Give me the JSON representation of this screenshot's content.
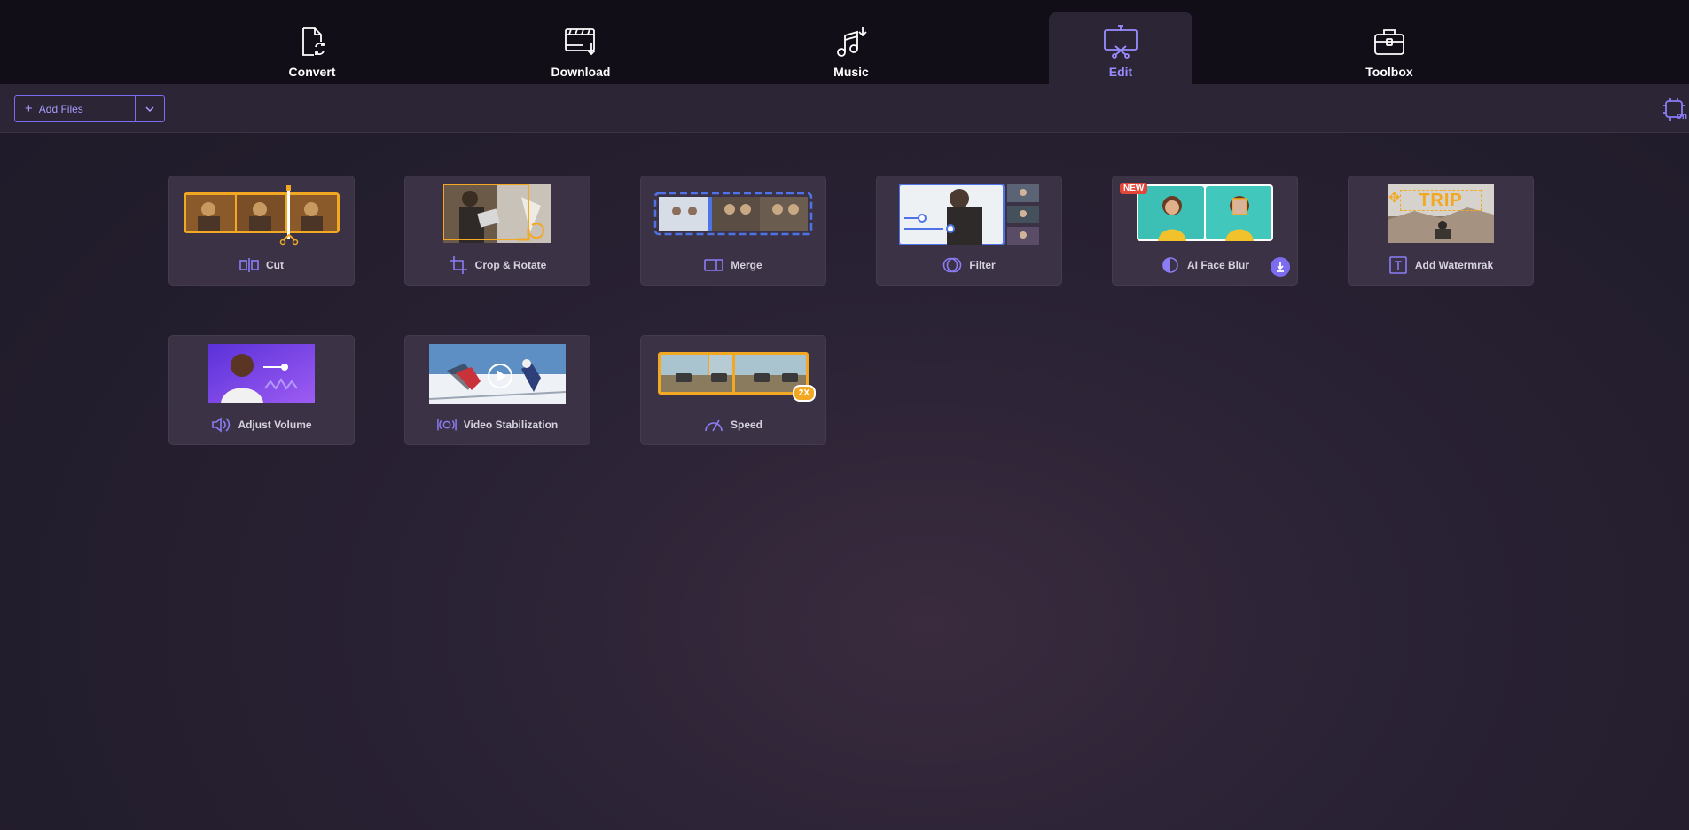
{
  "nav": {
    "tabs": [
      {
        "label": "Convert",
        "icon": "convert-icon"
      },
      {
        "label": "Download",
        "icon": "download-icon"
      },
      {
        "label": "Music",
        "icon": "music-icon"
      },
      {
        "label": "Edit",
        "icon": "edit-icon",
        "active": true
      },
      {
        "label": "Toolbox",
        "icon": "toolbox-icon"
      }
    ]
  },
  "toolbar": {
    "add_files_label": "Add Files",
    "gpu_label": "on"
  },
  "tools": [
    {
      "label": "Cut",
      "icon": "cut-icon"
    },
    {
      "label": "Crop & Rotate",
      "icon": "crop-icon"
    },
    {
      "label": "Merge",
      "icon": "merge-icon"
    },
    {
      "label": "Filter",
      "icon": "filter-icon"
    },
    {
      "label": "AI Face Blur",
      "icon": "face-blur-icon",
      "badge": "NEW"
    },
    {
      "label": "Add Watermrak",
      "icon": "watermark-icon",
      "thumb_text": "TRIP"
    },
    {
      "label": "Adjust Volume",
      "icon": "volume-icon"
    },
    {
      "label": "Video Stabilization",
      "icon": "stabilization-icon"
    },
    {
      "label": "Speed",
      "icon": "speed-icon",
      "badge": "2X"
    }
  ],
  "colors": {
    "accent": "#7b6cf0",
    "accent_text": "#9a8cff",
    "highlight_orange": "#f3a823",
    "card_bg": "#3b3345"
  }
}
